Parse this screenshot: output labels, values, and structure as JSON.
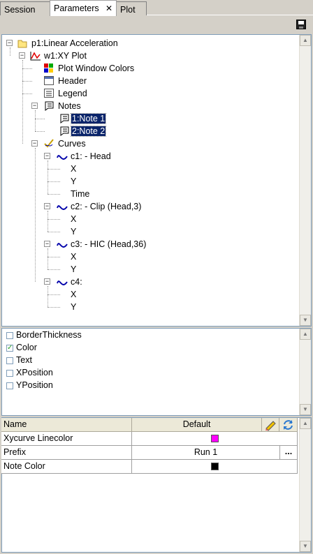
{
  "tabs": [
    {
      "label": "Session"
    },
    {
      "label": "Parameters",
      "close": "✕"
    },
    {
      "label": "Plot"
    }
  ],
  "toolbar": {
    "save_icon": "save-icon"
  },
  "tree": {
    "page": "p1:Linear Acceleration",
    "window": "w1:XY Plot",
    "plot_window_colors": "Plot Window Colors",
    "header": "Header",
    "legend": "Legend",
    "notes": "Notes",
    "note1": "1:Note 1",
    "note2": "2:Note 2",
    "curves": "Curves",
    "c1": "c1: - Head",
    "c2": "c2: - Clip (Head,3)",
    "c3": "c3: - HIC (Head,36)",
    "c4": "c4:",
    "x": "X",
    "y": "Y",
    "time": "Time"
  },
  "properties": [
    {
      "label": "BorderThickness",
      "checked": false
    },
    {
      "label": "Color",
      "checked": true
    },
    {
      "label": "Text",
      "checked": false
    },
    {
      "label": "XPosition",
      "checked": false
    },
    {
      "label": "YPosition",
      "checked": false
    }
  ],
  "grid": {
    "headers": {
      "name": "Name",
      "default": "Default"
    },
    "rows": [
      {
        "name": "Xycurve Linecolor",
        "value": "",
        "swatch": "#ff00ff"
      },
      {
        "name": "Prefix",
        "value": "Run 1",
        "button": "..."
      },
      {
        "name": "Note Color",
        "value": "",
        "swatch": "#000000"
      }
    ]
  },
  "colors": {
    "selection": "#0a246a",
    "curve": "#0000aa",
    "magenta": "#ff00ff"
  }
}
